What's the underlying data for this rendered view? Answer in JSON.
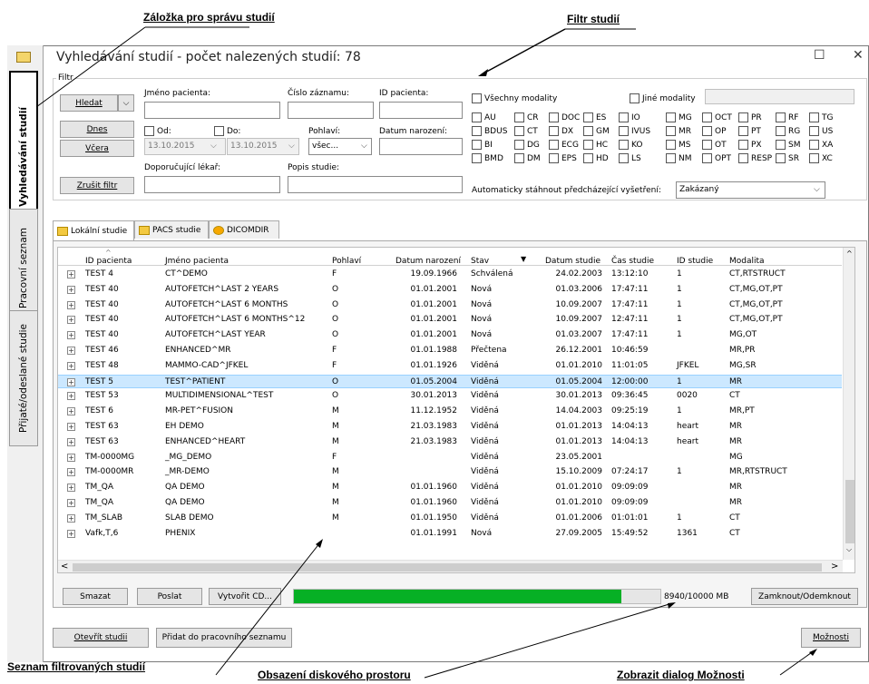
{
  "annotations": {
    "tab_management": "Záložka pro správu studií",
    "study_filter": "Filtr studií",
    "filtered_list": "Seznam filtrovaných studií",
    "disk_space": "Obsazení diskového prostoru",
    "options_dialog": "Zobrazit dialog Možnosti"
  },
  "window": {
    "title": "Vyhledávání studií - počet nalezených studií: 78",
    "maximize_glyph": "☐",
    "close_glyph": "✕"
  },
  "side_tabs": [
    "Vyhledávání studií",
    "Pracovní seznam",
    "Přijaté/odeslané studie"
  ],
  "filter": {
    "group_label": "Filtr",
    "search_label": "Hledat",
    "today_label": "Dnes",
    "yesterday_label": "Včera",
    "clear_label": "Zrušit filtr",
    "patient_name_label": "Jméno pacienta:",
    "record_number_label": "Číslo záznamu:",
    "patient_id_label": "ID pacienta:",
    "from_label": "Od:",
    "to_label": "Do:",
    "from_value": "13.10.2015",
    "to_value": "13.10.2015",
    "sex_label": "Pohlaví:",
    "sex_value": "všec...",
    "birth_date_label": "Datum narození:",
    "referring_label": "Doporučující lékař:",
    "description_label": "Popis studie:",
    "all_modalities": "Všechny modality",
    "other_modalities": "Jiné modality",
    "modalities": [
      [
        "AU",
        "CR",
        "DOC",
        "ES",
        "IO",
        "MG",
        "OCT",
        "PR",
        "RF",
        "TG"
      ],
      [
        "BDUS",
        "CT",
        "DX",
        "GM",
        "IVUS",
        "MR",
        "OP",
        "PT",
        "RG",
        "US"
      ],
      [
        "BI",
        "DG",
        "ECG",
        "HC",
        "KO",
        "MS",
        "OT",
        "PX",
        "SM",
        "XA"
      ],
      [
        "BMD",
        "DM",
        "EPS",
        "HD",
        "LS",
        "NM",
        "OPT",
        "RESP",
        "SR",
        "XC"
      ]
    ],
    "auto_download_label": "Automaticky stáhnout předcházející vyšetření:",
    "auto_download_value": "Zakázaný"
  },
  "tabs": [
    "Lokální studie",
    "PACS studie",
    "DICOMDIR"
  ],
  "table": {
    "columns": [
      "ID pacienta",
      "Jméno pacienta",
      "Pohlaví",
      "Datum narození",
      "Stav",
      "Datum studie",
      "Čas studie",
      "ID studie",
      "Modalita"
    ],
    "rows": [
      [
        "TEST 4",
        "CT^DEMO",
        "F",
        "19.09.1966",
        "Schválená",
        "24.02.2003",
        "13:12:10",
        "1",
        "CT,RTSTRUCT"
      ],
      [
        "TEST 40",
        "AUTOFETCH^LAST 2 YEARS",
        "O",
        "01.01.2001",
        "Nová",
        "01.03.2006",
        "17:47:11",
        "1",
        "CT,MG,OT,PT"
      ],
      [
        "TEST 40",
        "AUTOFETCH^LAST 6 MONTHS",
        "O",
        "01.01.2001",
        "Nová",
        "10.09.2007",
        "17:47:11",
        "1",
        "CT,MG,OT,PT"
      ],
      [
        "TEST 40",
        "AUTOFETCH^LAST 6 MONTHS^12",
        "O",
        "01.01.2001",
        "Nová",
        "10.09.2007",
        "12:47:11",
        "1",
        "CT,MG,OT,PT"
      ],
      [
        "TEST 40",
        "AUTOFETCH^LAST YEAR",
        "O",
        "01.01.2001",
        "Nová",
        "01.03.2007",
        "17:47:11",
        "1",
        "MG,OT"
      ],
      [
        "TEST 46",
        "ENHANCED^MR",
        "F",
        "01.01.1988",
        "Přečtena",
        "26.12.2001",
        "10:46:59",
        "",
        "MR,PR"
      ],
      [
        "TEST 48",
        "MAMMO-CAD^JFKEL",
        "F",
        "01.01.1926",
        "Viděná",
        "01.01.2010",
        "11:01:05",
        "JFKEL",
        "MG,SR"
      ],
      [
        "TEST 5",
        "TEST^PATIENT",
        "O",
        "01.05.2004",
        "Viděná",
        "01.05.2004",
        "12:00:00",
        "1",
        "MR"
      ],
      [
        "TEST 53",
        "MULTIDIMENSIONAL^TEST",
        "O",
        "30.01.2013",
        "Viděná",
        "30.01.2013",
        "09:36:45",
        "0020",
        "CT"
      ],
      [
        "TEST 6",
        "MR-PET^FUSION",
        "M",
        "11.12.1952",
        "Viděná",
        "14.04.2003",
        "09:25:19",
        "1",
        "MR,PT"
      ],
      [
        "TEST 63",
        "EH DEMO",
        "M",
        "21.03.1983",
        "Viděná",
        "01.01.2013",
        "14:04:13",
        "heart",
        "MR"
      ],
      [
        "TEST 63",
        "ENHANCED^HEART",
        "M",
        "21.03.1983",
        "Viděná",
        "01.01.2013",
        "14:04:13",
        "heart",
        "MR"
      ],
      [
        "TM-0000MG",
        "_MG_DEMO",
        "F",
        "",
        "Viděná",
        "23.05.2001",
        "",
        "",
        "MG"
      ],
      [
        "TM-0000MR",
        "_MR-DEMO",
        "M",
        "",
        "Viděná",
        "15.10.2009",
        "07:24:17",
        "1",
        "MR,RTSTRUCT"
      ],
      [
        "TM_QA",
        "QA DEMO",
        "M",
        "01.01.1960",
        "Viděná",
        "01.01.2010",
        "09:09:09",
        "",
        "MR"
      ],
      [
        "TM_QA",
        "QA DEMO",
        "M",
        "01.01.1960",
        "Viděná",
        "01.01.2010",
        "09:09:09",
        "",
        "MR"
      ],
      [
        "TM_SLAB",
        "SLAB DEMO",
        "M",
        "01.01.1950",
        "Viděná",
        "01.01.2006",
        "01:01:01",
        "1",
        "CT"
      ],
      [
        "Vafk,T,6",
        "PHENIX",
        "",
        "01.01.1991",
        "Nová",
        "27.09.2005",
        "15:49:52",
        "1361",
        "CT"
      ]
    ],
    "selected_row": 7
  },
  "bottom": {
    "delete_label": "Smazat",
    "send_label": "Poslat",
    "create_cd_label": "Vytvořit CD...",
    "disk_text": "8940/10000 MB",
    "disk_fraction": 0.894,
    "lock_label": "Zamknout/Odemknout",
    "open_label": "Otevřít studii",
    "add_worklist_label": "Přidat do pracovního seznamu",
    "options_label": "Možnosti"
  },
  "colors": {
    "progress": "#06b025",
    "selected_row": "#cce8ff"
  }
}
